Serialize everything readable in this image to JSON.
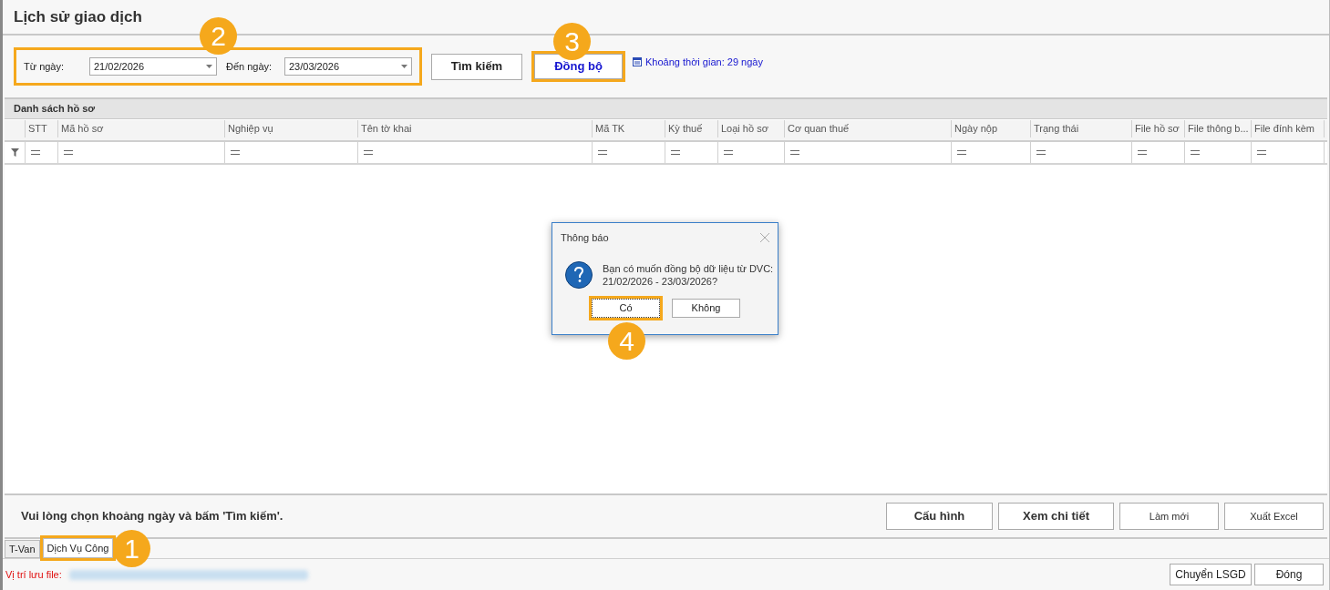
{
  "window": {
    "title": "Lịch sử giao dịch"
  },
  "filter": {
    "highlighted": true,
    "from": {
      "label": "Từ ngày:",
      "value": "21/02/2026"
    },
    "to": {
      "label": "Đến ngày:",
      "value": "23/03/2026"
    },
    "search_button": {
      "label": "Tìm kiếm",
      "highlighted": false
    },
    "sync_button": {
      "label": "Đồng bộ",
      "highlighted": true
    },
    "period": "Khoảng thời gian: 29 ngày"
  },
  "grid": {
    "title": "Danh sách hồ sơ",
    "columns": [
      "STT",
      "Mã hồ sơ",
      "Nghiệp vụ",
      "Tên tờ khai",
      "Mã TK",
      "Kỳ thuế",
      "Loại hồ sơ",
      "Cơ quan thuế",
      "Ngày nộp",
      "Trạng thái",
      "File hồ sơ",
      "File thông b...",
      "File đính kèm"
    ]
  },
  "dialog": {
    "title": "Thông báo",
    "message": "Bạn có muốn đồng bộ dữ liệu từ DVC:\n21/02/2026 - 23/03/2026?",
    "buttons": [
      {
        "label": "Có",
        "highlighted": true
      },
      {
        "label": "Không",
        "highlighted": false
      }
    ]
  },
  "bottom_bar": {
    "message": "Vui lòng chọn khoảng ngày và bấm 'Tìm kiếm'.",
    "buttons": [
      {
        "label": "Cấu hình",
        "bold": true
      },
      {
        "label": "Xem chi tiết",
        "bold": true
      },
      {
        "label": "Làm mới",
        "bold": false
      },
      {
        "label": "Xuất Excel",
        "bold": false
      }
    ]
  },
  "tabs": [
    {
      "label": "T-Van",
      "selected": false,
      "highlighted": false
    },
    {
      "label": "Dịch Vụ Công",
      "selected": true,
      "highlighted": true
    }
  ],
  "footer": {
    "label": "Vị trí lưu file:",
    "buttons": [
      "Chuyển LSGD",
      "Đóng"
    ]
  },
  "callouts": [
    {
      "number": "2"
    },
    {
      "number": "3"
    },
    {
      "number": "4"
    },
    {
      "number": "1"
    }
  ]
}
